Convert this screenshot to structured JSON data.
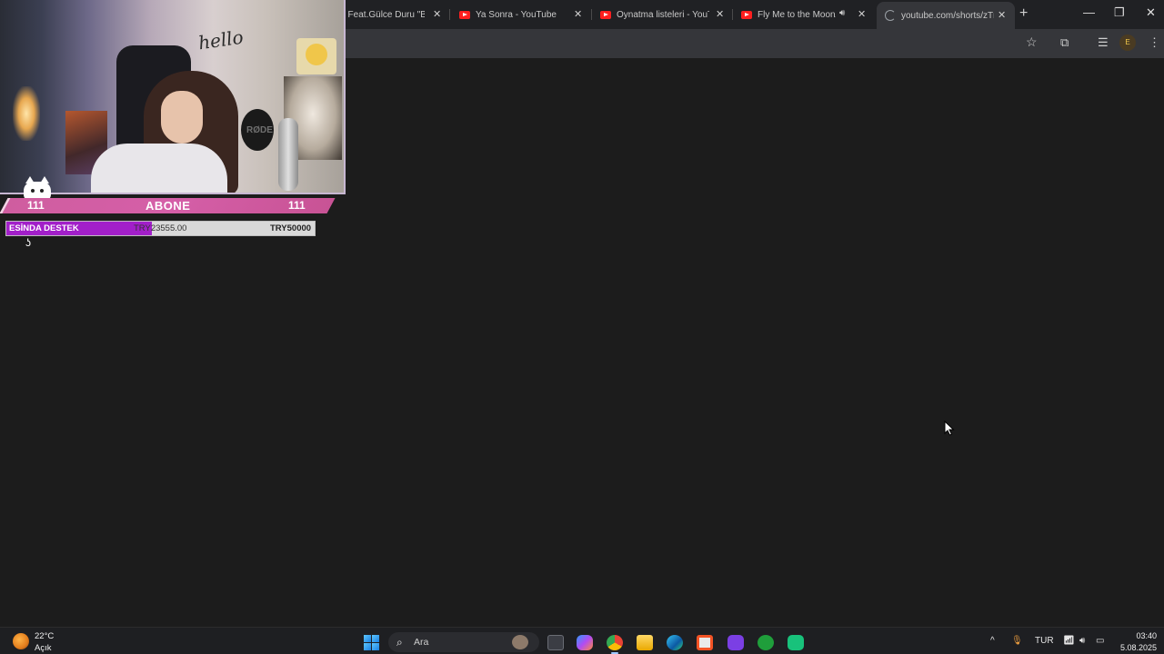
{
  "browser": {
    "tabs": [
      {
        "title": "pi Feat.Gülce Duru \"BU",
        "favicon": "youtube-icon"
      },
      {
        "title": "Ya Sonra - YouTube",
        "favicon": "youtube-icon"
      },
      {
        "title": "Oynatma listeleri - YouTub",
        "favicon": "youtube-icon"
      },
      {
        "title": "Fly Me to the Moon/",
        "favicon": "youtube-icon",
        "audio": true
      },
      {
        "title": "youtube.com/shorts/zTm",
        "favicon": "loading-icon",
        "active": true
      }
    ],
    "close_glyph": "✕",
    "new_tab_glyph": "+",
    "window_controls": {
      "minimize": "—",
      "maximize": "❐",
      "close": "✕"
    },
    "toolbar": {
      "bookmark_star": "☆",
      "extensions": "⧉",
      "media": "☰",
      "profile_initial": "E",
      "menu": "⋮"
    }
  },
  "stream_overlay": {
    "greeting": "hello",
    "mic_brand": "RØDE",
    "subscriber_bar": {
      "left_count": "111",
      "label": "ABONE",
      "right_count": "111"
    },
    "donation_goal": {
      "label": "ESİNDA DESTEK",
      "current": "TRY23555.00",
      "target": "TRY50000",
      "progress_fraction": 0.471
    }
  },
  "taskbar": {
    "weather": {
      "temp": "22°C",
      "condition": "Açık"
    },
    "search_placeholder": "Ara",
    "apps": [
      "file-explorer-icon",
      "copilot-icon",
      "chrome-icon",
      "folder-icon",
      "edge-icon",
      "store-icon",
      "app-purple-icon",
      "xbox-icon",
      "app-green-icon"
    ],
    "tray": {
      "chevron": "^",
      "mic": "🎙",
      "language": "TUR",
      "wifi": "wifi-icon",
      "volume": "volume-icon",
      "battery": "battery-icon"
    },
    "clock": {
      "time": "03:40",
      "date": "5.08.2025"
    }
  },
  "colors": {
    "youtube_red": "#ff1f1f",
    "abone_pink": "#d55fa8",
    "goal_purple": "#a21fc9",
    "page_bg": "#1c1c1c"
  }
}
